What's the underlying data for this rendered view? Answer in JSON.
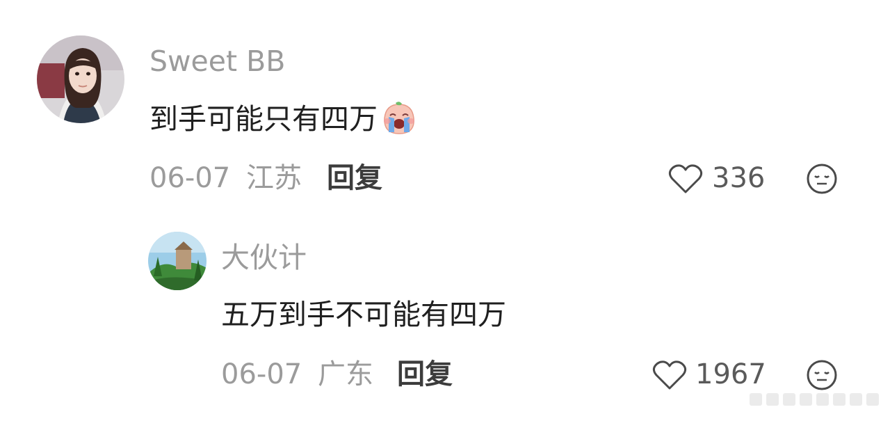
{
  "comments": [
    {
      "username": "Sweet BB",
      "content": "到手可能只有四万",
      "emoji_icon": "crying-face-emoji-icon",
      "date": "06-07",
      "location": "江苏",
      "reply_label": "回复",
      "likes": "336"
    },
    {
      "username": "大伙计",
      "content": "五万到手不可能有四万",
      "date": "06-07",
      "location": "广东",
      "reply_label": "回复",
      "likes": "1967"
    }
  ]
}
